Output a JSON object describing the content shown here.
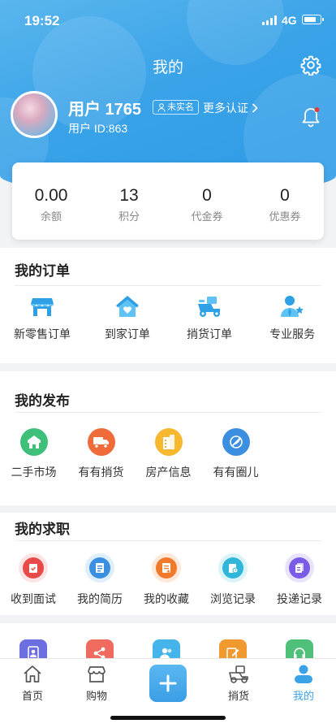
{
  "status": {
    "time": "19:52",
    "network": "4G",
    "battery_level": 0.8
  },
  "header": {
    "title": "我的"
  },
  "user": {
    "name": "用户 1765",
    "badge": "未实名",
    "more_cert": "更多认证",
    "id_text": "用户 ID:863"
  },
  "wallet": [
    {
      "value": "0.00",
      "label": "余额"
    },
    {
      "value": "13",
      "label": "积分"
    },
    {
      "value": "0",
      "label": "代金券"
    },
    {
      "value": "0",
      "label": "优惠券"
    }
  ],
  "orders": {
    "title": "我的订单",
    "items": [
      {
        "label": "新零售订单",
        "icon": "storefront-icon"
      },
      {
        "label": "到家订单",
        "icon": "home-heart-icon"
      },
      {
        "label": "捎货订单",
        "icon": "delivery-scooter-icon"
      },
      {
        "label": "专业服务",
        "icon": "professional-person-icon"
      }
    ]
  },
  "publish": {
    "title": "我的发布",
    "items": [
      {
        "label": "二手市场",
        "icon": "secondhand-market-icon",
        "color": "#3fc07a"
      },
      {
        "label": "有有捎货",
        "icon": "truck-icon",
        "color": "#ef6b3a"
      },
      {
        "label": "房产信息",
        "icon": "building-icon",
        "color": "#f5b82e"
      },
      {
        "label": "有有圈儿",
        "icon": "circle-feather-icon",
        "color": "#3b8fe0"
      }
    ]
  },
  "jobs": {
    "title": "我的求职",
    "items": [
      {
        "label": "收到面试",
        "icon": "interview-clipboard-icon",
        "color": "#e84a4a"
      },
      {
        "label": "我的简历",
        "icon": "resume-icon",
        "color": "#3b8fe0"
      },
      {
        "label": "我的收藏",
        "icon": "favorites-list-icon",
        "color": "#f07a2a"
      },
      {
        "label": "浏览记录",
        "icon": "browse-history-icon",
        "color": "#2fb6d8"
      },
      {
        "label": "投递记录",
        "icon": "delivery-record-icon",
        "color": "#7a5be6"
      }
    ]
  },
  "tools_partial": [
    {
      "icon": "contacts-icon",
      "color": "#6c6fe0"
    },
    {
      "icon": "share-icon",
      "color": "#f06b5f"
    },
    {
      "icon": "friends-icon",
      "color": "#44b4ea"
    },
    {
      "icon": "edit-icon",
      "color": "#f0992e"
    },
    {
      "icon": "headset-icon",
      "color": "#4fc07a"
    }
  ],
  "tabbar": {
    "items": [
      {
        "label": "首页",
        "icon": "home-icon"
      },
      {
        "label": "购物",
        "icon": "shop-icon"
      },
      {
        "label": "",
        "icon": "plus-icon"
      },
      {
        "label": "捎货",
        "icon": "scooter-icon"
      },
      {
        "label": "我的",
        "icon": "profile-icon",
        "active": true
      }
    ]
  },
  "colors": {
    "accent": "#3aa3e8",
    "header": "#4aaeed"
  }
}
